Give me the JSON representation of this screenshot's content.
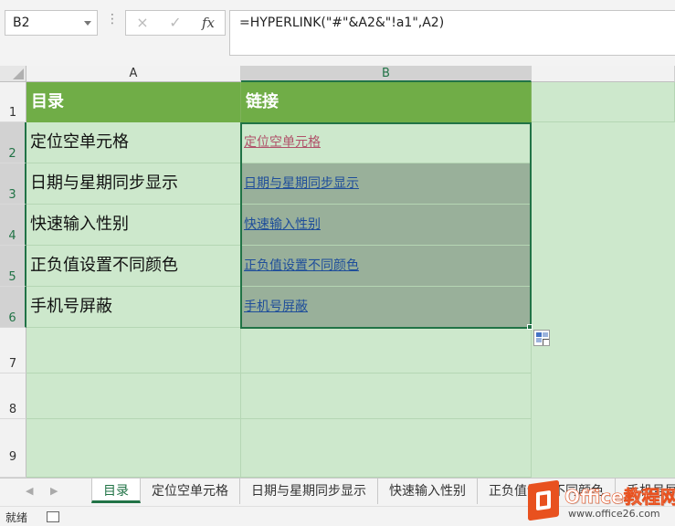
{
  "formula_bar": {
    "name_box": "B2",
    "cancel_icon": "×",
    "enter_icon": "✓",
    "fx_label": "fx",
    "formula": "=HYPERLINK(\"#\"&A2&\"!a1\",A2)"
  },
  "columns": [
    "A",
    "B"
  ],
  "rows": [
    "1",
    "2",
    "3",
    "4",
    "5",
    "6",
    "7",
    "8",
    "9"
  ],
  "table": {
    "header": {
      "a": "目录",
      "b": "链接"
    },
    "items": [
      {
        "name": "定位空单元格",
        "link": "定位空单元格"
      },
      {
        "name": "日期与星期同步显示",
        "link": "日期与星期同步显示"
      },
      {
        "name": "快速输入性别",
        "link": "快速输入性别"
      },
      {
        "name": "正负值设置不同颜色",
        "link": "正负值设置不同颜色"
      },
      {
        "name": "手机号屏蔽",
        "link": "手机号屏蔽"
      }
    ]
  },
  "sheet_tabs": [
    "目录",
    "定位空单元格",
    "日期与星期同步显示",
    "快速输入性别",
    "正负值设置不同颜色",
    "手机号屏蔽"
  ],
  "status": {
    "text": "就绪"
  },
  "watermark": {
    "title": "Office教程网",
    "url": "www.office26.com"
  },
  "colors": {
    "header_green": "#70ad47",
    "grid_green": "#cde8cc",
    "excel_green": "#217346",
    "link_blue": "#1f4e9a",
    "visited": "#b0526a"
  }
}
